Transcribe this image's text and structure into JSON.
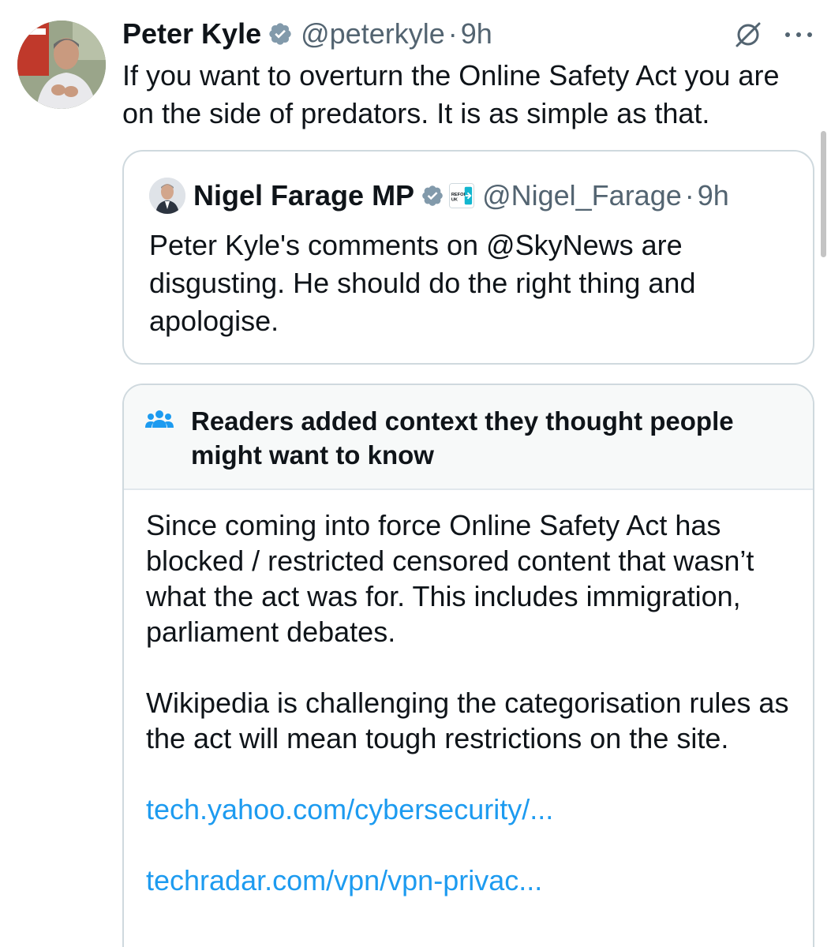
{
  "tweet": {
    "author": {
      "display_name": "Peter Kyle",
      "handle": "@peterkyle",
      "verified": true
    },
    "separator": "·",
    "time": "9h",
    "text": "If you want to overturn the Online Safety Act you are on the side of predators. It is as simple as that."
  },
  "quote": {
    "author": {
      "display_name": "Nigel Farage MP",
      "handle": "@Nigel_Farage",
      "verified": true,
      "affiliation_badge_text": "REFORM UK"
    },
    "separator": "·",
    "time": "9h",
    "text": "Peter Kyle's comments on @SkyNews are disgusting. He should do the right thing and apologise."
  },
  "community_note": {
    "title": "Readers added context they thought people might want to know",
    "paragraphs": [
      "Since coming into force Online Safety Act has blocked / restricted censored content that wasn’t what the act was for. This includes immigration, parliament debates.",
      "Wikipedia is challenging the categorisation rules as the act will mean tough restrictions on the site."
    ],
    "links": [
      "tech.yahoo.com/cybersecurity/...",
      "techradar.com/vpn/vpn-privac..."
    ]
  },
  "icons": {
    "verified": "verified-badge-icon",
    "grok": "grok-icon",
    "more": "more-options-icon",
    "note": "people-icon"
  },
  "colors": {
    "text": "#0f1419",
    "secondary_text": "#536471",
    "link": "#1d9bf0",
    "verified": "#829aab",
    "border": "#cfd9de",
    "note_header_bg": "#f7f9f9"
  }
}
